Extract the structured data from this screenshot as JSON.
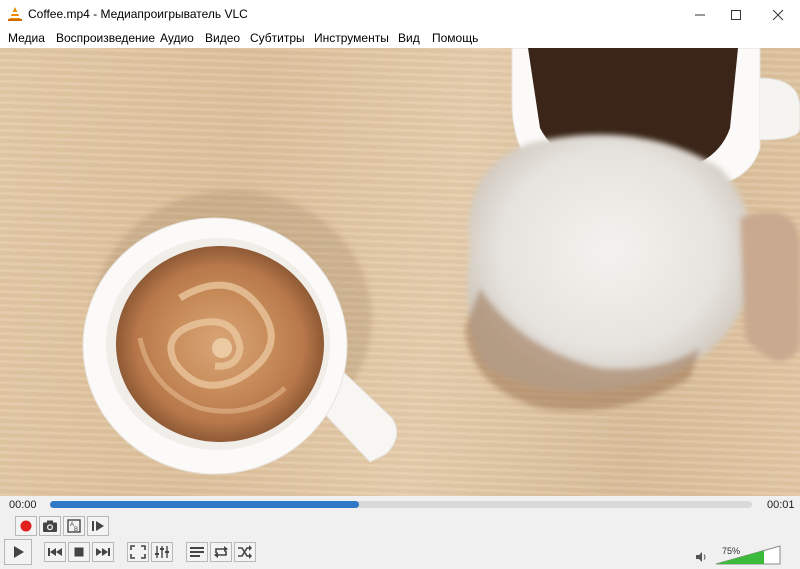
{
  "window": {
    "title": "Coffee.mp4 - Медиапроигрыватель VLC"
  },
  "menu": [
    "Медиа",
    "Воспроизведение",
    "Аудио",
    "Видео",
    "Субтитры",
    "Инструменты",
    "Вид",
    "Помощь"
  ],
  "playback": {
    "elapsed": "00:00",
    "duration": "00:01",
    "progress": 0.44
  },
  "volume": {
    "label": "75%",
    "level": 0.75
  },
  "colors": {
    "seek_fill": "#3079c7",
    "record": "#e0201f",
    "volume_fill": "#3cba3c",
    "vlc_orange": "#f28b00"
  },
  "icons": {
    "record": "record-icon",
    "snapshot": "camera-icon",
    "loop_ab": "ab-loop-icon",
    "frame_step": "frame-step-icon",
    "play": "play-icon",
    "prev": "previous-icon",
    "stop": "stop-icon",
    "next": "next-icon",
    "fullscreen": "fullscreen-icon",
    "extended": "extended-settings-icon",
    "playlist": "playlist-icon",
    "loop": "loop-icon",
    "shuffle": "shuffle-icon",
    "speaker": "speaker-icon"
  }
}
